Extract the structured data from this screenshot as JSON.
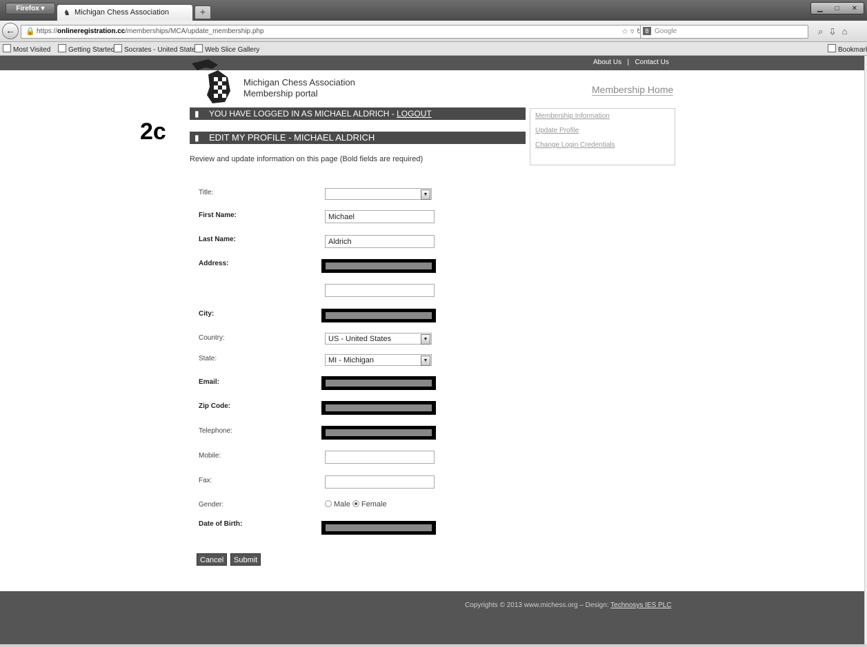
{
  "browser": {
    "menu_label": "Firefox ▾",
    "tab_title": "Michigan Chess Association",
    "newtab_label": "+",
    "url_prefix": "https://",
    "url_host": "onlineregistration.cc",
    "url_path": "/memberships/MCA/update_membership.php",
    "search_engine": "Google",
    "bookmarks": [
      "Most Visited",
      "Getting Started",
      "Socrates - United States",
      "Web Slice Gallery"
    ],
    "bookmarks_menu": "Bookmarks"
  },
  "site": {
    "about": "About Us",
    "separator": "|",
    "contact": "Contact Us",
    "org_line1": "Michigan Chess Association",
    "org_line2": "Membership portal",
    "membership_home": "Membership Home"
  },
  "bars": {
    "logged_in": "YOU HAVE LOGGED IN AS MICHAEL ALDRICH - ",
    "logout": "LOGOUT",
    "edit_profile": "EDIT MY PROFILE - MICHAEL ALDRICH"
  },
  "sidebar": {
    "links": [
      "Membership Information",
      "Update Profile",
      "Change Login Credentials"
    ]
  },
  "annotation": "2c",
  "intro": "Review and update information on this page (Bold fields are required)",
  "form": {
    "title_label": "Title:",
    "first_name_label": "First Name:",
    "first_name": "Michael",
    "last_name_label": "Last Name:",
    "last_name": "Aldrich",
    "address_label": "Address:",
    "city_label": "City:",
    "country_label": "Country:",
    "country": "US - United States",
    "state_label": "State:",
    "state": "MI - Michigan",
    "email_label": "Email:",
    "zip_label": "Zip Code:",
    "telephone_label": "Telephone:",
    "mobile_label": "Mobile:",
    "fax_label": "Fax:",
    "gender_label": "Gender:",
    "gender_male": "Male",
    "gender_female": "Female",
    "dob_label": "Date of Birth:",
    "cancel": "Cancel",
    "submit": "Submit"
  },
  "footer": {
    "copyright": "Copyrights © 2013 www.michess.org – Design: ",
    "designer": "Technosys IES PLC"
  }
}
